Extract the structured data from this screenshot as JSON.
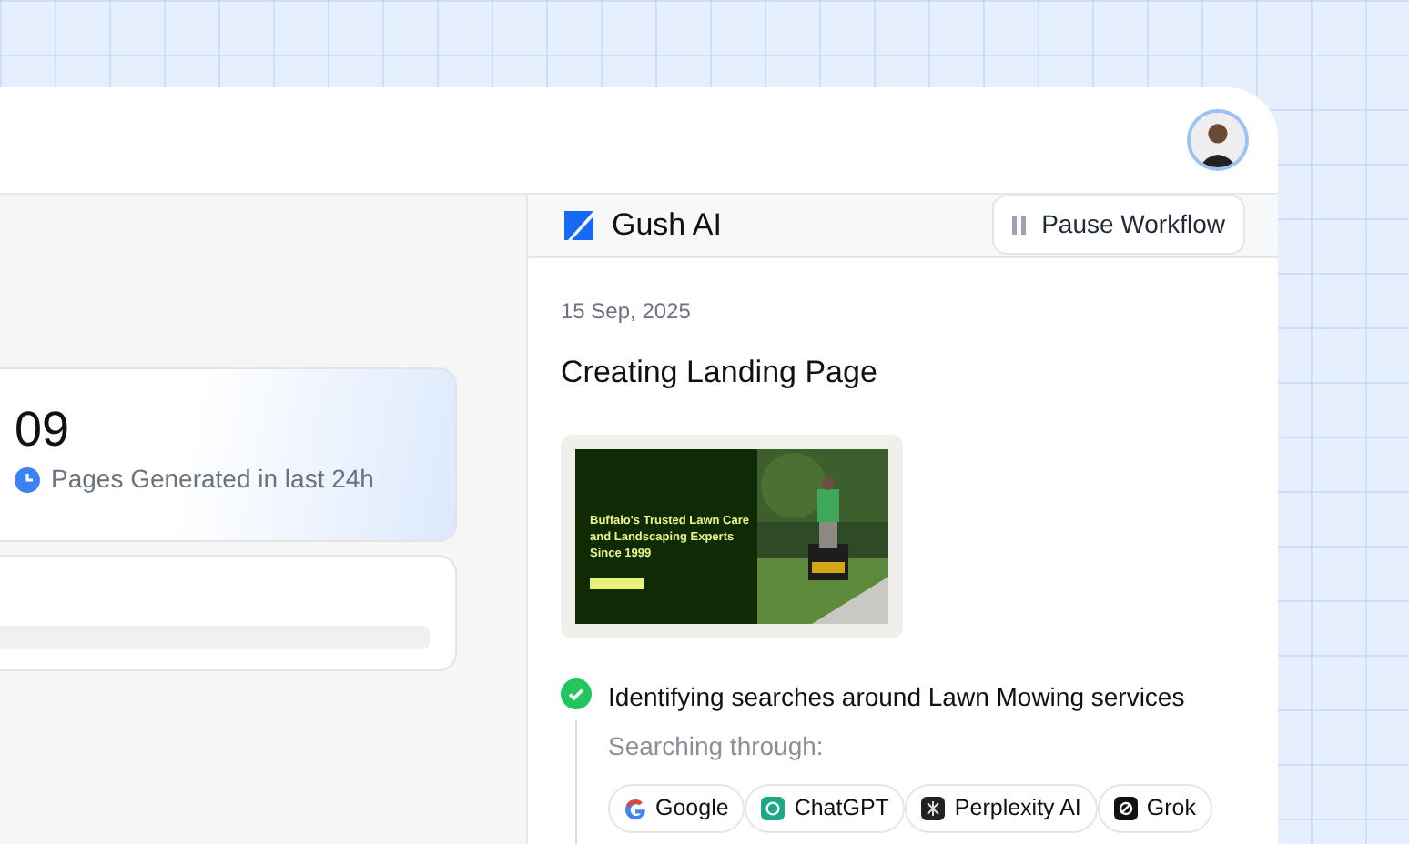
{
  "stats": [
    {
      "value": "09",
      "caption": "Pages Generated in last 24h",
      "kind": "count"
    },
    {
      "kind": "progress"
    }
  ],
  "agent": {
    "name": "Gush AI",
    "pause_button": "Pause Workflow"
  },
  "feed": {
    "date": "15 Sep, 2025",
    "title": "Creating Landing Page",
    "preview": {
      "headline": "Buffalo's Trusted Lawn Care and Landscaping Experts Since 1999"
    },
    "steps": [
      {
        "text": "Identifying searches around Lawn Mowing services",
        "done": true,
        "subtitle": "Searching through:",
        "sources": [
          {
            "label": "Google",
            "kind": "google"
          },
          {
            "label": "ChatGPT",
            "kind": "chatgpt"
          },
          {
            "label": "Perplexity AI",
            "kind": "perplexity"
          },
          {
            "label": "Grok",
            "kind": "grok"
          }
        ]
      }
    ]
  }
}
